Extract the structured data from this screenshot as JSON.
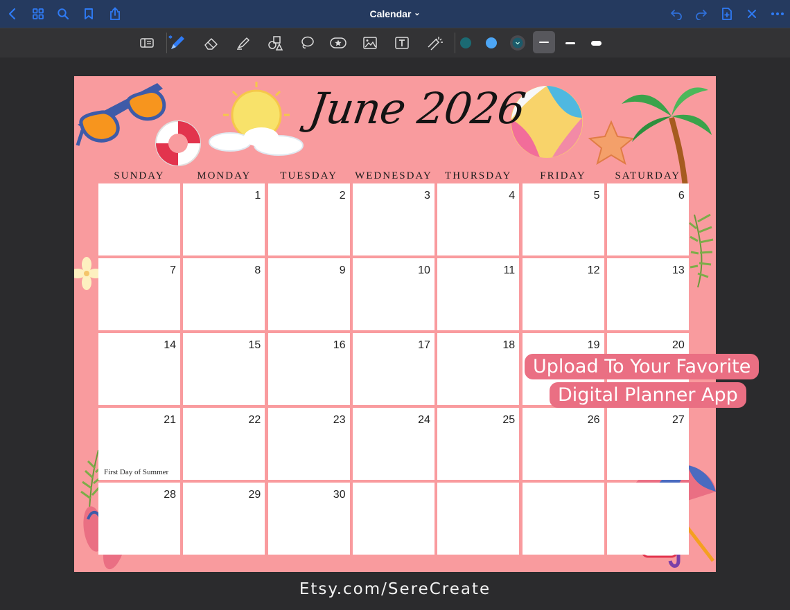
{
  "app": {
    "title": "Calendar",
    "title_chevron": "⌄"
  },
  "colors": {
    "topbar": "#253a5f",
    "toolbar": "#333335",
    "accent": "#2f7bf5",
    "page": "#f99b9e",
    "banner": "#ea6f83",
    "pen_teal": "#1b6a73",
    "pen_blue": "#4da6f5"
  },
  "toolbar_icons": [
    "page-view-icon",
    "pen-icon",
    "eraser-icon",
    "highlighter-icon",
    "shapes-icon",
    "lasso-icon",
    "sticker-icon",
    "image-icon",
    "text-box-icon",
    "laser-pointer-icon",
    "color-teal",
    "color-blue",
    "color-picker",
    "stroke-thin",
    "stroke-medium",
    "stroke-thick"
  ],
  "calendar": {
    "month_title": "June 2026",
    "weekdays": [
      "SUNDAY",
      "MONDAY",
      "TUESDAY",
      "WEDNESDAY",
      "THURSDAY",
      "FRIDAY",
      "SATURDAY"
    ],
    "weeks": [
      [
        "",
        "1",
        "2",
        "3",
        "4",
        "5",
        "6"
      ],
      [
        "7",
        "8",
        "9",
        "10",
        "11",
        "12",
        "13"
      ],
      [
        "14",
        "15",
        "16",
        "17",
        "18",
        "19",
        "20"
      ],
      [
        "21",
        "22",
        "23",
        "24",
        "25",
        "26",
        "27"
      ],
      [
        "28",
        "29",
        "30",
        "",
        "",
        "",
        ""
      ]
    ],
    "notes": {
      "21": "First Day of Summer"
    }
  },
  "banner": {
    "line1": "Upload To Your Favorite",
    "line2": "Digital Planner App"
  },
  "footer": "Etsy.com/SereCreate"
}
